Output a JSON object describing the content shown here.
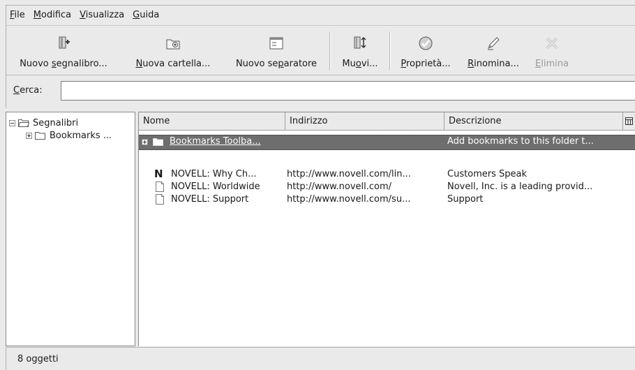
{
  "menu": [
    {
      "label": "File",
      "mn": "F",
      "rest": "ile"
    },
    {
      "label": "Modifica",
      "mn": "M",
      "rest": "odifica"
    },
    {
      "label": "Visualizza",
      "mn": "V",
      "rest": "isualizza"
    },
    {
      "label": "Guida",
      "mn": "G",
      "rest": "uida"
    }
  ],
  "toolbar": {
    "new_bookmark": {
      "pre": "Nuovo ",
      "mn": "s",
      "post": "egnalibro..."
    },
    "new_folder": {
      "pre": "",
      "mn": "N",
      "post": "uova cartella..."
    },
    "new_separator": {
      "pre": "Nuovo se",
      "mn": "p",
      "post": "aratore"
    },
    "move": {
      "pre": "Mu",
      "mn": "o",
      "post": "vi..."
    },
    "properties": {
      "pre": "",
      "mn": "P",
      "post": "roprietà..."
    },
    "rename": {
      "pre": "",
      "mn": "R",
      "post": "inomina..."
    },
    "delete": {
      "pre": "",
      "mn": "E",
      "post": "limina"
    }
  },
  "search": {
    "mn": "C",
    "rest": "erca:",
    "value": ""
  },
  "tree": {
    "root": "Segnalibri",
    "child": "Bookmarks ..."
  },
  "columns": {
    "name": "Nome",
    "address": "Indirizzo",
    "description": "Descrizione"
  },
  "rows": [
    {
      "name": "Bookmarks Toolba...",
      "address": "",
      "description": "Add bookmarks to this folder t...",
      "icon": "folder-icon"
    },
    {
      "name": "NOVELL: Why Ch...",
      "address": "http://www.novell.com/lin...",
      "description": "Customers Speak",
      "icon": "novell-icon"
    },
    {
      "name": "NOVELL: Worldwide",
      "address": "http://www.novell.com/",
      "description": "Novell, Inc. is a leading provid...",
      "icon": "page-icon"
    },
    {
      "name": "NOVELL: Support",
      "address": "http://www.novell.com/su...",
      "description": "Support",
      "icon": "page-icon"
    }
  ],
  "status": "8 oggetti",
  "colors": {
    "selection": "#6e6e6e",
    "window": "#eaeaea"
  }
}
